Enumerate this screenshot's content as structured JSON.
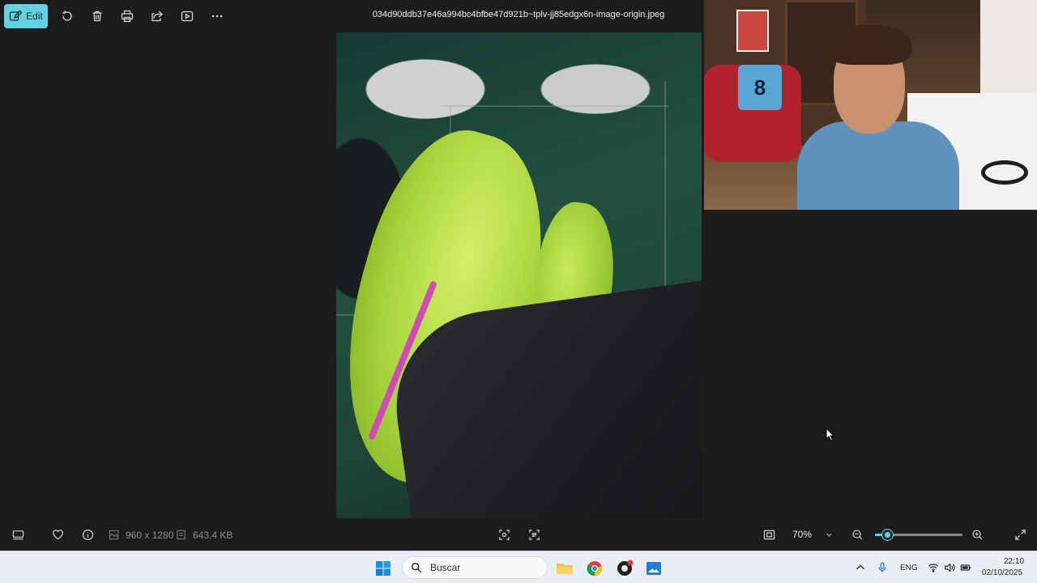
{
  "toolbar": {
    "edit_label": "Edit",
    "file_title": "034d90ddb37e46a994bc4bfbe47d921b~tplv-jj85edgx6n-image-origin.jpeg"
  },
  "webcam": {
    "jersey_number": "8"
  },
  "statusbar": {
    "dimensions": "960 x 1280",
    "file_size": "643.4 KB",
    "zoom_value": "70%",
    "zoom_level_fraction": 0.14
  },
  "taskbar": {
    "search_placeholder": "Buscar",
    "language": "ENG",
    "time": "22:10",
    "date": "02/10/2025"
  },
  "colors": {
    "accent": "#65d1de",
    "app_background": "#1c1c1c",
    "taskbar_background": "#e9eef5"
  }
}
